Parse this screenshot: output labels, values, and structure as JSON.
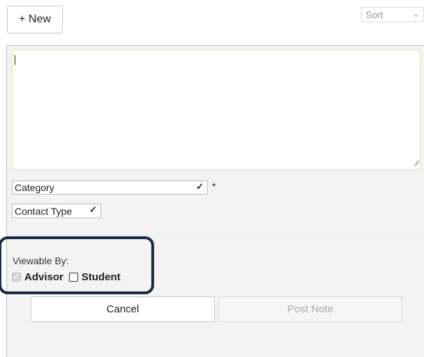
{
  "toolbar": {
    "new_label": "+ New",
    "sort": {
      "selected": "Sort"
    }
  },
  "note_form": {
    "note_text": "",
    "category": {
      "selected": "Category",
      "required_mark": "*"
    },
    "contact_type": {
      "selected": "Contact Type"
    },
    "viewable_by": {
      "label": "Viewable By:",
      "advisor": {
        "label": "Advisor",
        "checked": true,
        "disabled": true
      },
      "student": {
        "label": "Student",
        "checked": false
      }
    },
    "cancel_label": "Cancel",
    "post_label": "Post Note"
  },
  "colors": {
    "panel_bg": "#f3f3f3",
    "highlight_border": "#1b2b44",
    "textarea_focus_border": "#d4e89a",
    "disabled_text": "#a8a8a8"
  }
}
